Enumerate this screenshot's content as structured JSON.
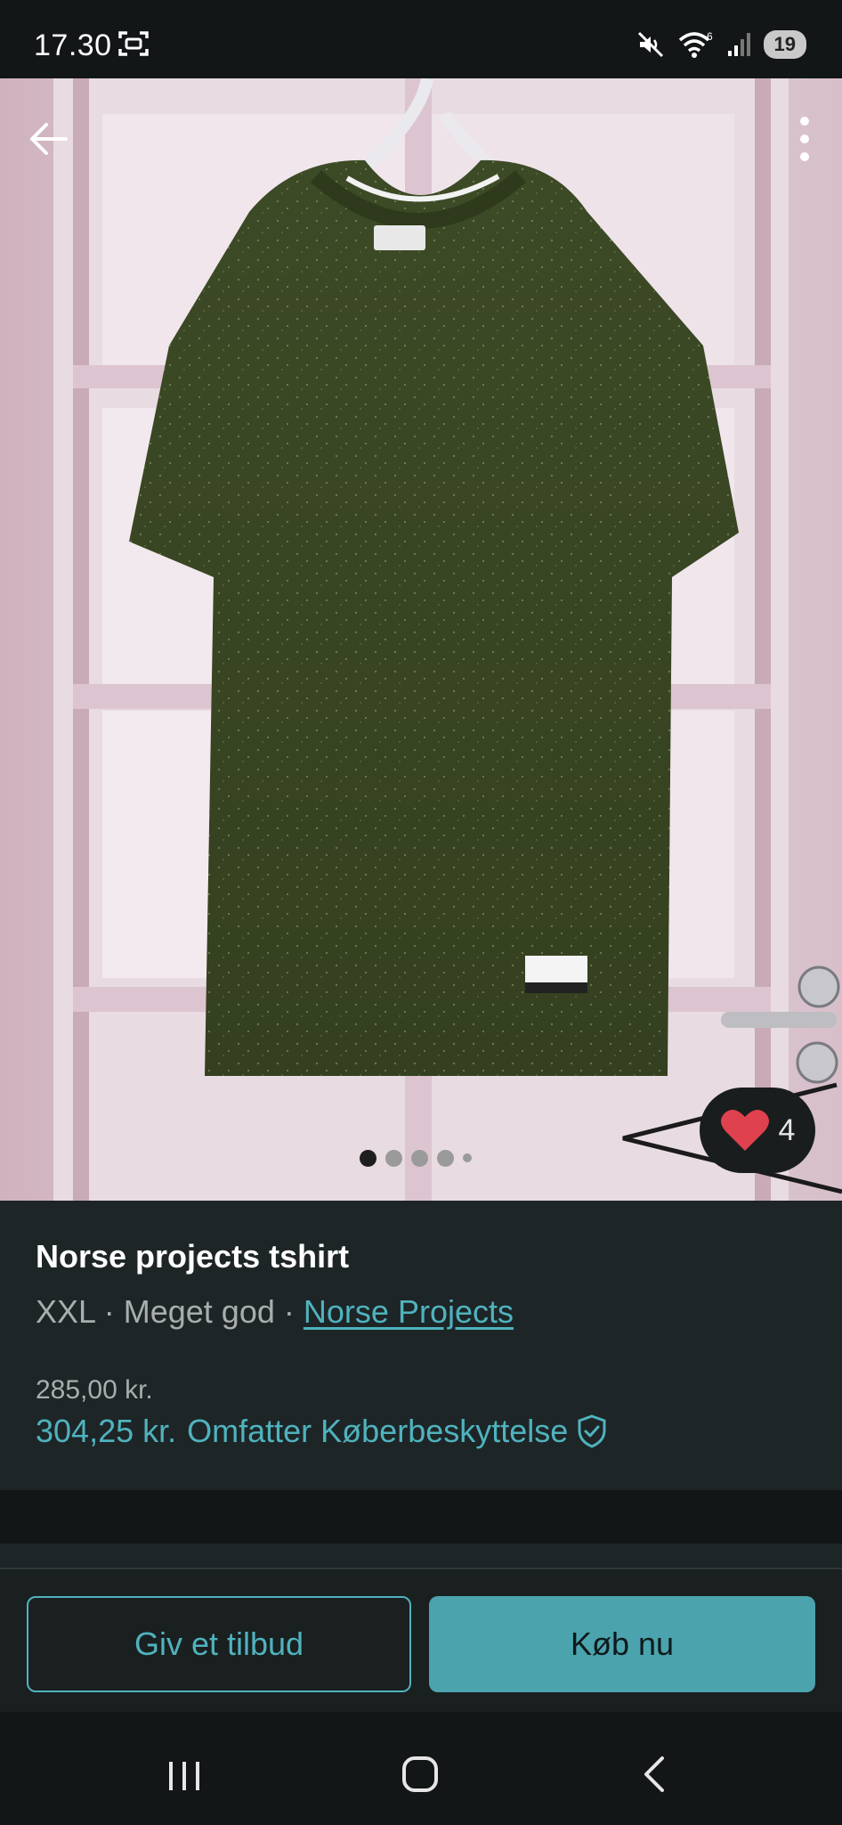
{
  "status_bar": {
    "time": "17.30",
    "battery": "19",
    "network_badge": "6",
    "icons": [
      "screenshot-icon",
      "mute-icon",
      "wifi-icon",
      "signal-icon",
      "battery-icon"
    ]
  },
  "photo": {
    "image_count": 5,
    "active_index": 0,
    "like_count": "4",
    "icons": [
      "back-arrow-icon",
      "more-vert-icon",
      "heart-icon"
    ]
  },
  "listing": {
    "title": "Norse projects tshirt",
    "size": "XXL",
    "separator": "·",
    "condition": "Meget god",
    "brand": "Norse Projects",
    "price": "285,00 kr.",
    "total_price": "304,25 kr.",
    "protection_label": "Omfatter Køberbeskyttelse",
    "protection_icon": "shield-check-icon"
  },
  "actions": {
    "offer_label": "Giv et tilbud",
    "buy_label": "Køb nu"
  },
  "colors": {
    "accent": "#4fb3be",
    "background": "#1e2527",
    "heart": "#e0414f"
  },
  "navbar": {
    "icons": [
      "recents-icon",
      "home-icon",
      "back-icon"
    ]
  }
}
